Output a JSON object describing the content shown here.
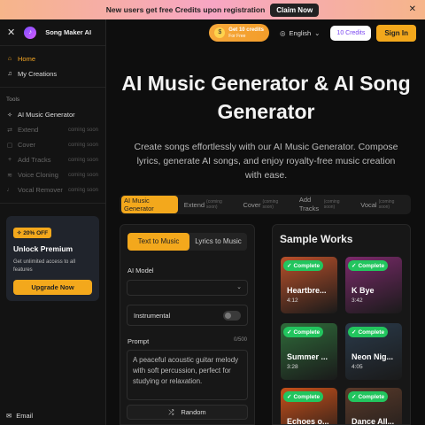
{
  "banner": {
    "text": "New users get free Credits upon registration",
    "button": "Claim Now",
    "close": "✕"
  },
  "sidebar": {
    "close": "✕",
    "brand": "Song Maker AI",
    "nav": [
      {
        "label": "Home",
        "icon": "home-icon"
      },
      {
        "label": "My Creations",
        "icon": "music-note-icon"
      }
    ],
    "tools_label": "Tools",
    "tools": [
      {
        "label": "AI Music Generator",
        "soon": ""
      },
      {
        "label": "Extend",
        "soon": "coming soon"
      },
      {
        "label": "Cover",
        "soon": "coming soon"
      },
      {
        "label": "Add Tracks",
        "soon": "coming soon"
      },
      {
        "label": "Voice Cloning",
        "soon": "coming soon"
      },
      {
        "label": "Vocal Remover",
        "soon": "coming soon"
      }
    ],
    "promo": {
      "badge": "20% OFF",
      "title": "Unlock Premium",
      "desc": "Get unlimited access to all features",
      "button": "Upgrade Now"
    },
    "email": "Email"
  },
  "topbar": {
    "credits_main": "Get 10 credits",
    "credits_sub": "For Free",
    "language": "English",
    "credits_count": "10 Credits",
    "signin": "Sign In"
  },
  "hero": {
    "title_line1": "AI Music Generator & AI Song",
    "title_line2": "Generator",
    "subtitle": "Create songs effortlessly with our AI Music Generator. Compose lyrics, generate AI songs, and enjoy royalty-free music creation with ease."
  },
  "tabs": [
    {
      "label": "AI Music Generator",
      "soon": ""
    },
    {
      "label": "Extend",
      "soon": "(coming soon)"
    },
    {
      "label": "Cover",
      "soon": "(coming soon)"
    },
    {
      "label": "Add Tracks",
      "soon": "(coming soon)"
    },
    {
      "label": "Vocal",
      "soon": "(coming soon)"
    }
  ],
  "form": {
    "mode_a": "Text to Music",
    "mode_b": "Lyrics to Music",
    "model_label": "AI Model",
    "instrumental_label": "Instrumental",
    "prompt_label": "Prompt",
    "prompt_count": "0/500",
    "prompt_placeholder": "A peaceful acoustic guitar melody with soft percussion, perfect for studying or relaxation.",
    "random_label": "Random"
  },
  "samples": {
    "title": "Sample Works",
    "badge": "Complete",
    "items": [
      {
        "title": "Heartbre...",
        "time": "4:12",
        "color": "#b8502a"
      },
      {
        "title": "K Bye",
        "time": "3:42",
        "color": "#7a2a6a"
      },
      {
        "title": "Summer ...",
        "time": "3:28",
        "color": "#2f6b3a"
      },
      {
        "title": "Neon Nig...",
        "time": "4:05",
        "color": "#2a3a4a"
      },
      {
        "title": "Echoes o...",
        "time": "",
        "color": "#c8501a"
      },
      {
        "title": "Dance All...",
        "time": "",
        "color": "#5a3a2a"
      }
    ]
  }
}
